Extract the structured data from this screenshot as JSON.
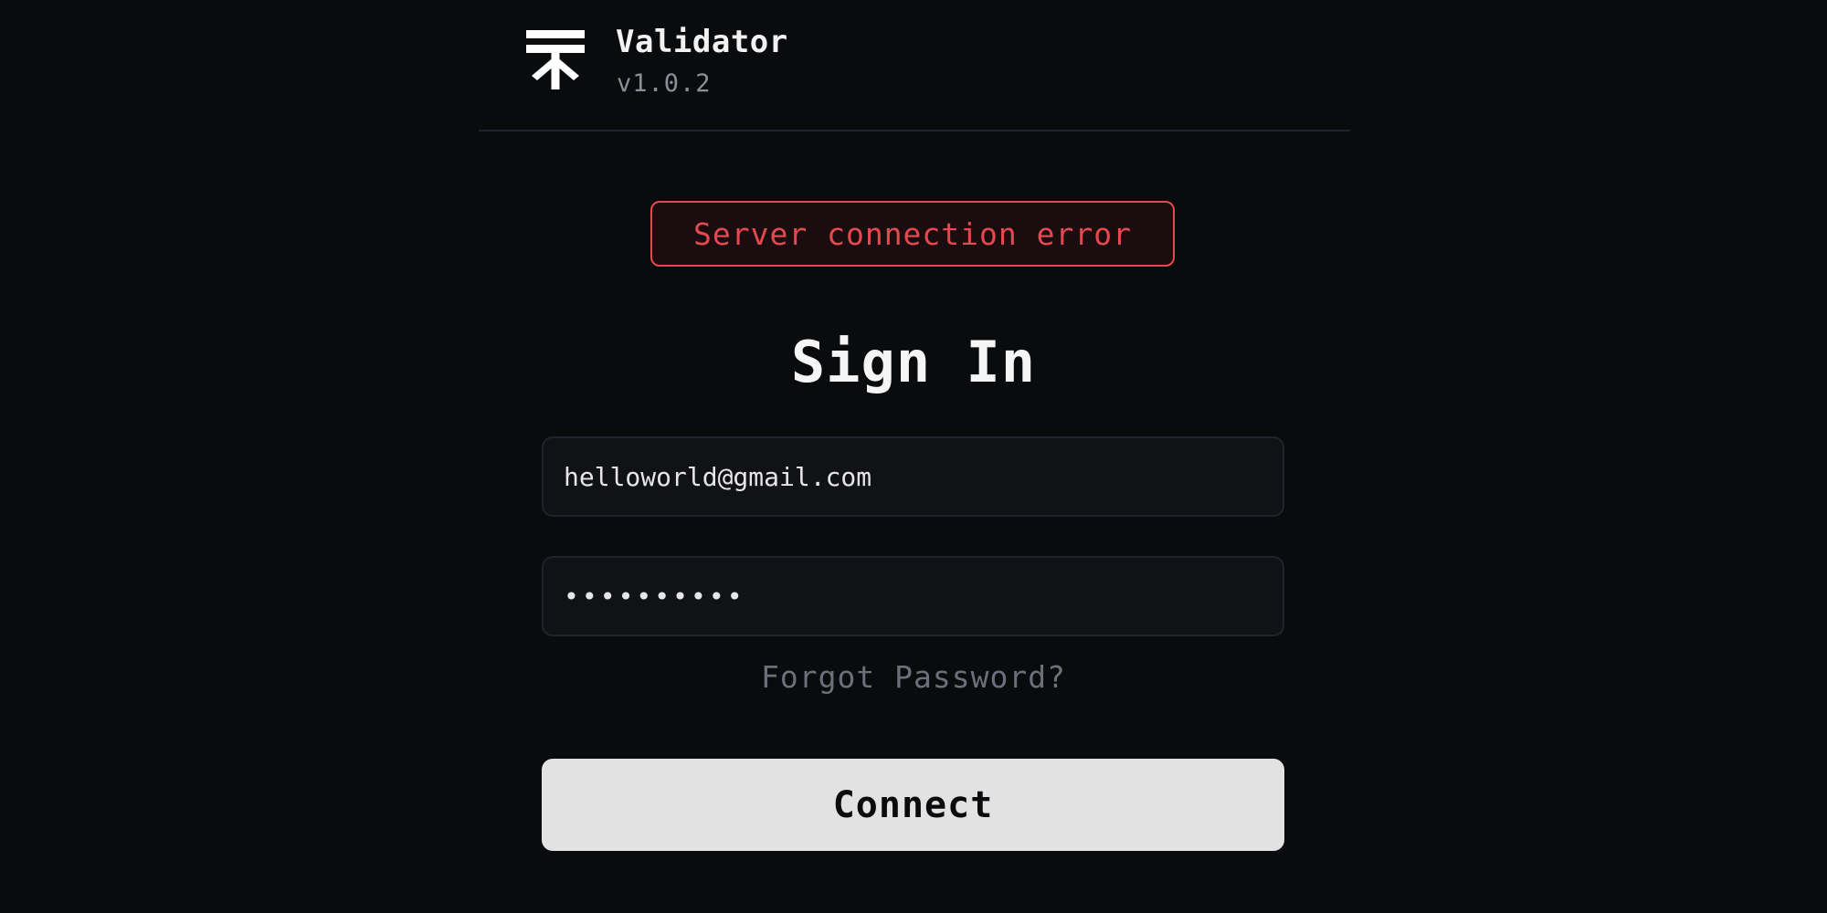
{
  "header": {
    "logo_icon": "validator-logo-icon",
    "title": "Validator",
    "version": "v1.0.2"
  },
  "alert": {
    "message": "Server connection error",
    "color": "#e5484d"
  },
  "form": {
    "title": "Sign In",
    "email_value": "helloworld@gmail.com",
    "password_value": "••••••••••",
    "forgot_label": "Forgot Password?",
    "submit_label": "Connect"
  },
  "colors": {
    "background": "#0a0b0d",
    "error": "#e5484d",
    "button": "#e2e2e2",
    "muted_text": "#6b707a"
  }
}
